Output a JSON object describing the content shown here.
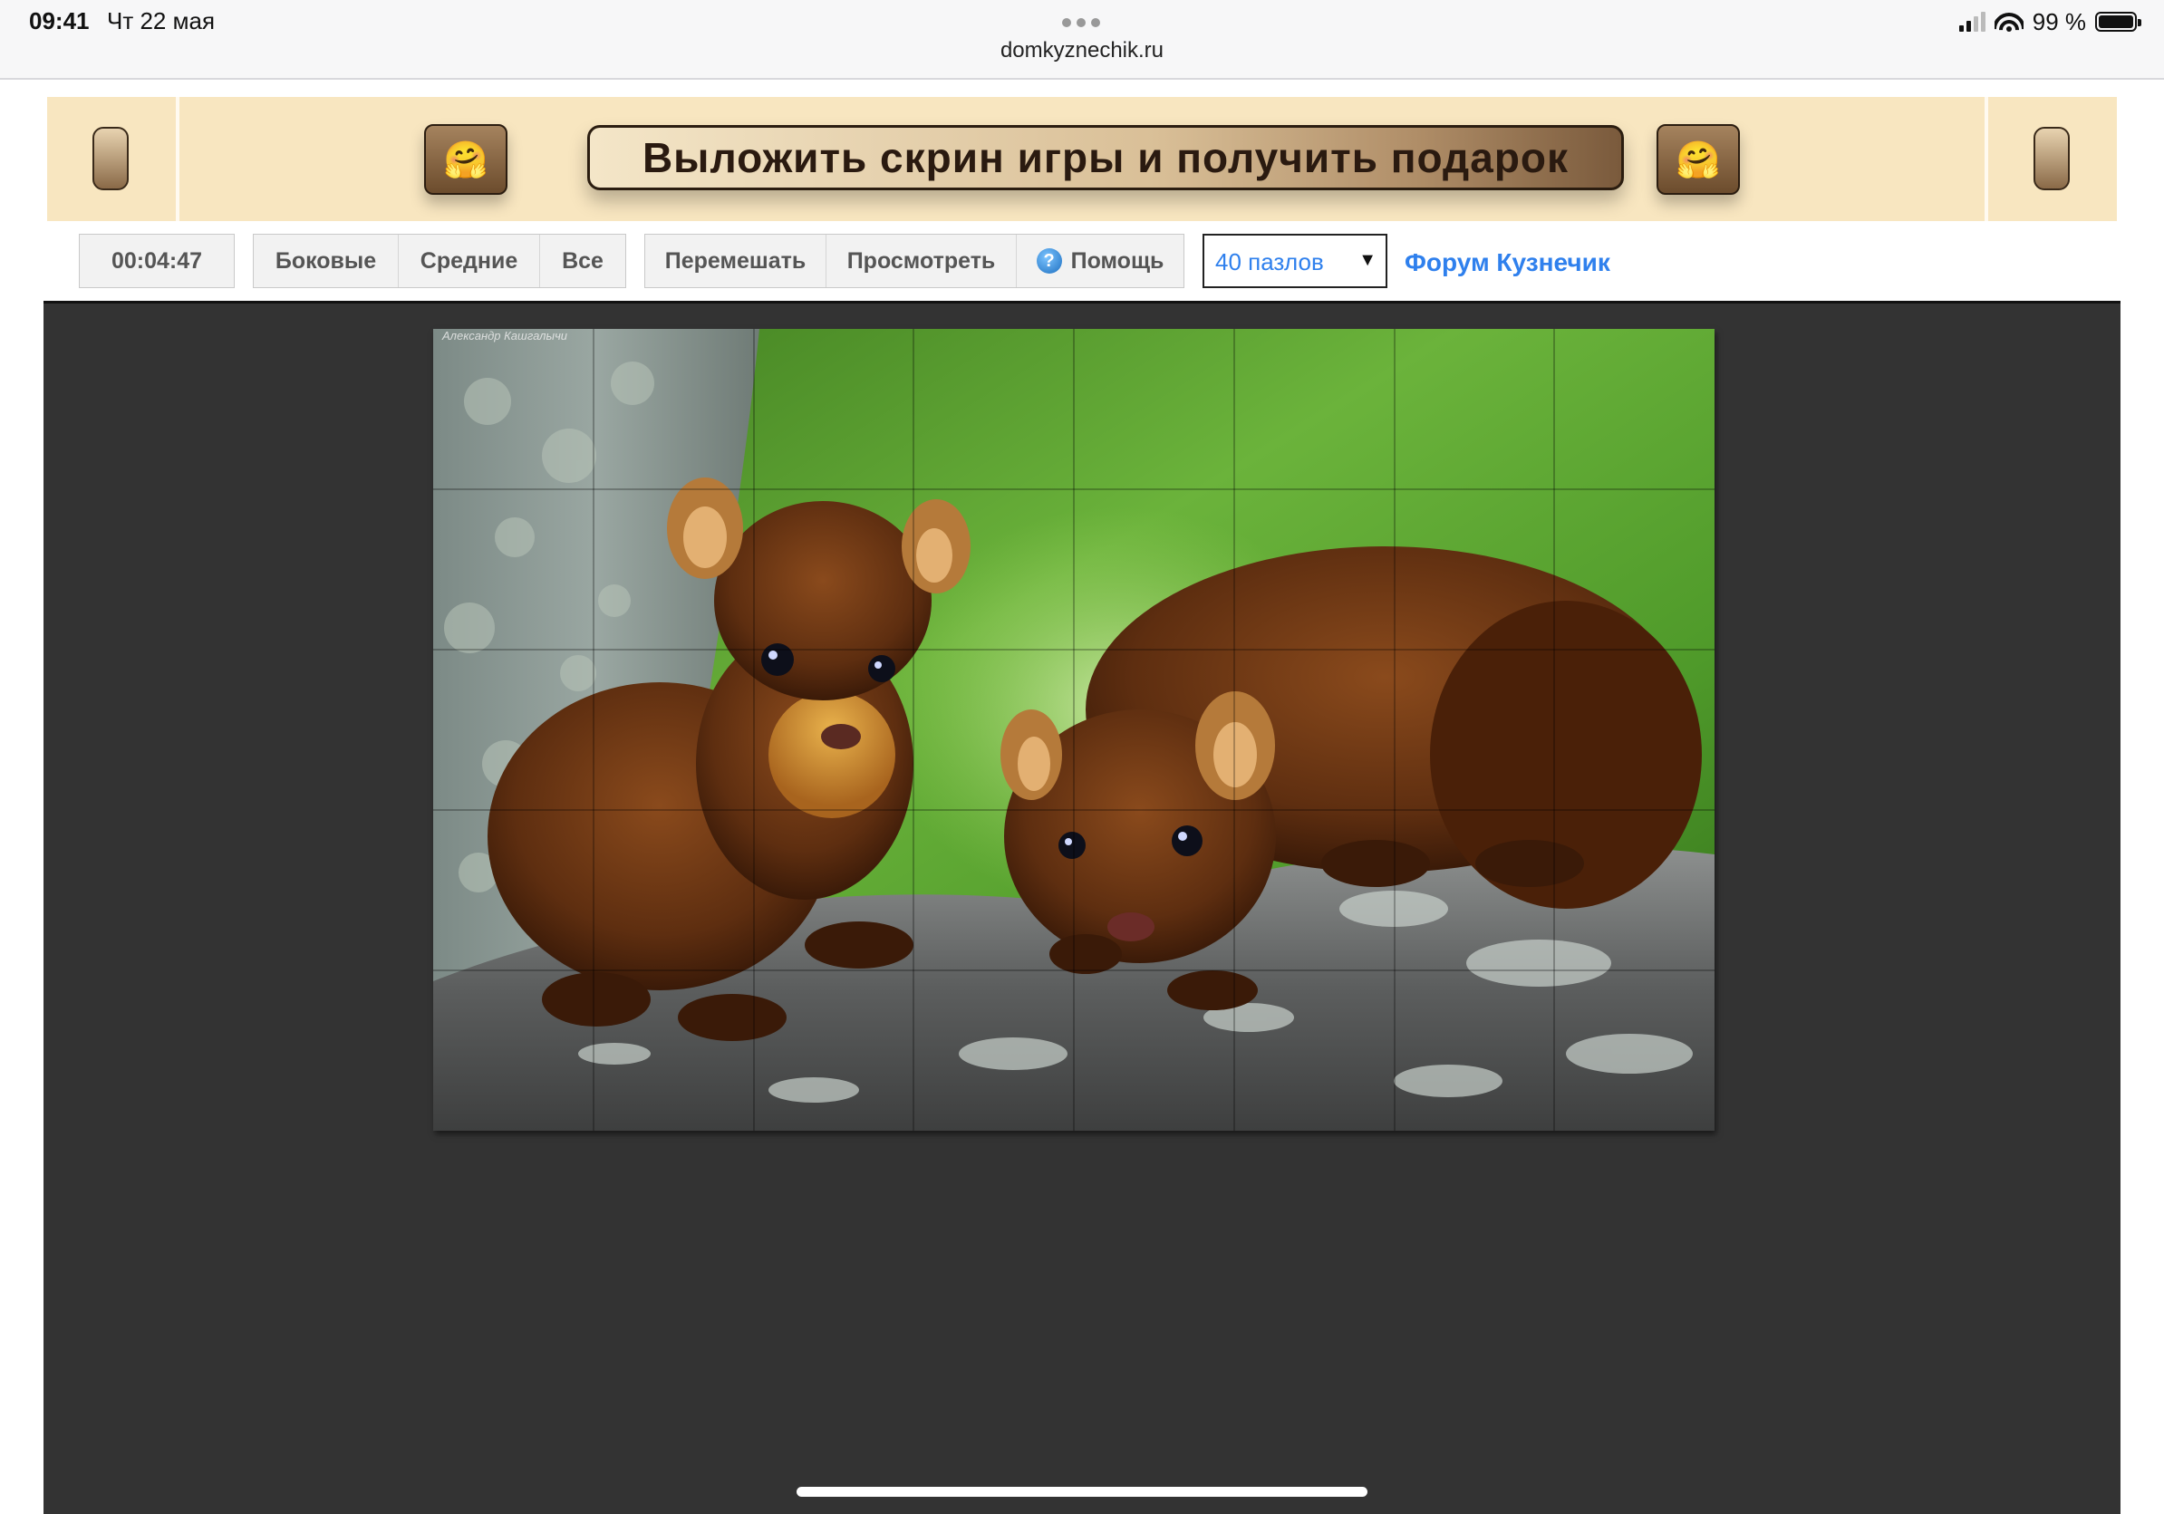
{
  "status_bar": {
    "time": "09:41",
    "date": "Чт 22 мая",
    "url": "domkyznechik.ru",
    "battery_text": "99 %",
    "battery_level": 0.99,
    "signal_bars_active": 2,
    "signal_bars_total": 4
  },
  "banner": {
    "title": "Выложить скрин игры и получить подарок",
    "emoji_left": "🤗",
    "emoji_right": "🤗"
  },
  "toolbar": {
    "timer": "00:04:47",
    "filter_buttons": [
      "Боковые",
      "Средние",
      "Все"
    ],
    "action_buttons": {
      "shuffle": "Перемешать",
      "preview": "Просмотреть",
      "help": "Помощь"
    },
    "pieces_select": {
      "value": "40 пазлов"
    },
    "forum_link": "Форум Кузнечик"
  },
  "puzzle": {
    "columns": 8,
    "rows": 5,
    "signature": "Александр Кашгалычи"
  },
  "colors": {
    "accent_blue": "#2f80ed",
    "banner_bg": "#f8e6c0",
    "board_bg": "#333333"
  }
}
